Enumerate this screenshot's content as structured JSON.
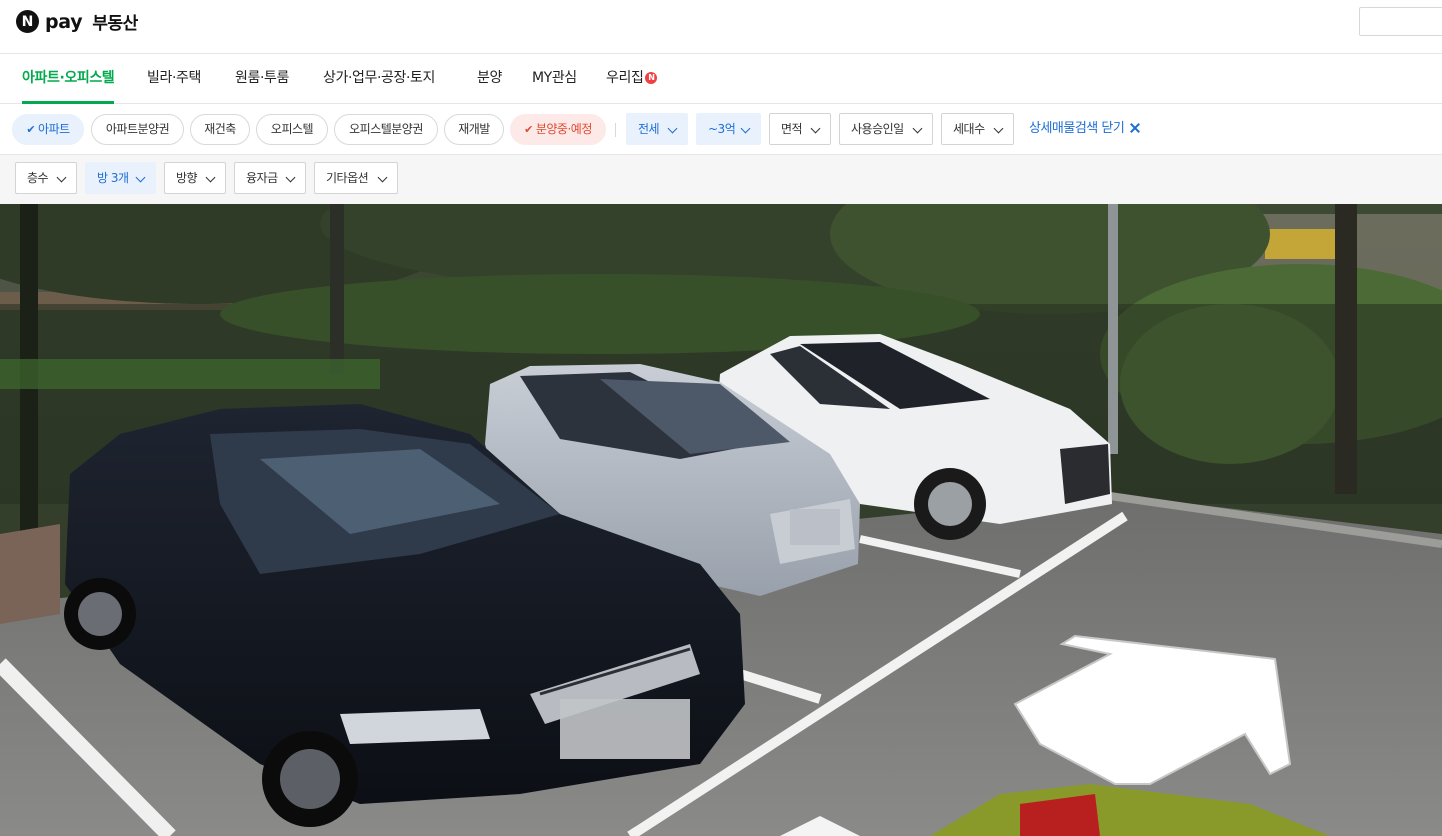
{
  "header": {
    "logo_mark": "N",
    "logo_pay": "pay",
    "service_name": "부동산",
    "search": {
      "placeholder": ""
    }
  },
  "category_tabs": [
    {
      "label": "아파트·오피스텔",
      "active": true
    },
    {
      "label": "빌라·주택",
      "active": false
    },
    {
      "label": "원룸·투룸",
      "active": false
    },
    {
      "label": "상가·업무·공장·토지",
      "active": false
    },
    {
      "label": "분양",
      "active": false
    },
    {
      "label": "MY관심",
      "active": false
    },
    {
      "label": "우리집",
      "active": false,
      "badge": "N"
    }
  ],
  "property_type_chips": [
    {
      "label": "아파트",
      "selected": true,
      "checkmark": "✔"
    },
    {
      "label": "아파트분양권",
      "selected": false
    },
    {
      "label": "재건축",
      "selected": false
    },
    {
      "label": "오피스텔",
      "selected": false
    },
    {
      "label": "오피스텔분양권",
      "selected": false
    },
    {
      "label": "재개발",
      "selected": false
    },
    {
      "label": "분양중·예정",
      "selected": true,
      "checkmark": "✔"
    }
  ],
  "main_filters": [
    {
      "label": "전세",
      "active": true
    },
    {
      "label": "~3억",
      "active": true
    },
    {
      "label": "면적",
      "active": false
    },
    {
      "label": "사용승인일",
      "active": false
    },
    {
      "label": "세대수",
      "active": false
    }
  ],
  "detail_search_close": "상세매물검색 닫기",
  "detail_filters": [
    {
      "label": "층수",
      "active": false
    },
    {
      "label": "방 3개",
      "active": true
    },
    {
      "label": "방향",
      "active": false
    },
    {
      "label": "융자금",
      "active": false
    },
    {
      "label": "기타옵션",
      "active": false
    }
  ],
  "colors": {
    "brand_green": "#03a94e",
    "filter_blue": "#1d6ed6",
    "filter_blue_bg": "#e8f1fc",
    "chip_red": "#e2492f",
    "chip_red_bg": "#fdeae8",
    "badge_red": "#ef4141"
  },
  "street_view": {
    "description_icon": "street-view-panorama",
    "navigation_arrow": "arrow-forward-icon"
  }
}
